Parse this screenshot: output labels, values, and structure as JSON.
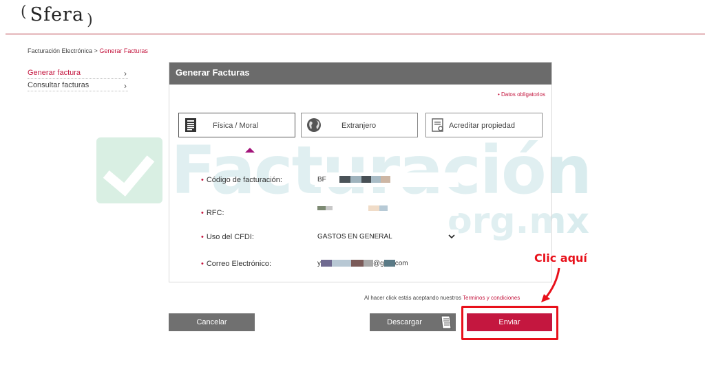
{
  "header": {
    "logo_text": "Sfera",
    "paren_left": "(",
    "paren_right": ")"
  },
  "breadcrumb": {
    "parent": "Facturación Electrónica >",
    "current": "Generar Facturas"
  },
  "sidebar": {
    "items": [
      {
        "label": "Generar factura",
        "chevron": "›",
        "active": true
      },
      {
        "label": "Consultar facturas",
        "chevron": "›",
        "active": false
      }
    ]
  },
  "watermark": {
    "main": "Facturación",
    "sub": "org.mx"
  },
  "panel": {
    "title": "Generar Facturas",
    "required_note": "• Datos obligatorios",
    "types": [
      {
        "label": "Física / Moral",
        "icon": "document-icon",
        "selected": true
      },
      {
        "label": "Extranjero",
        "icon": "globe-icon",
        "selected": false
      },
      {
        "label": "Acreditar propiedad",
        "icon": "certificate-icon",
        "selected": false
      }
    ],
    "fields": {
      "codigo": {
        "star": "•",
        "label": "Código de facturación:",
        "value": "BF"
      },
      "rfc": {
        "star": "•",
        "label": "RFC:",
        "value": ""
      },
      "uso": {
        "star": "•",
        "label": "Uso del CFDI:",
        "value": "GASTOS EN GENERAL"
      },
      "correo": {
        "star": "•",
        "label": "Correo Electrónico:",
        "value_prefix": "y",
        "value_mid": "@g",
        "value_suffix": "com"
      }
    }
  },
  "terms": {
    "text": "Al hacer click estás aceptando nuestros",
    "link": "Terminos y condiciones"
  },
  "buttons": {
    "cancel": "Cancelar",
    "download": "Descargar",
    "send": "Enviar"
  },
  "annotation": {
    "text": "Clic aquí",
    "color": "#e8101a"
  },
  "colors": {
    "accent": "#c4173f",
    "header_gray": "#6b6b6b",
    "button_gray": "#707070"
  }
}
